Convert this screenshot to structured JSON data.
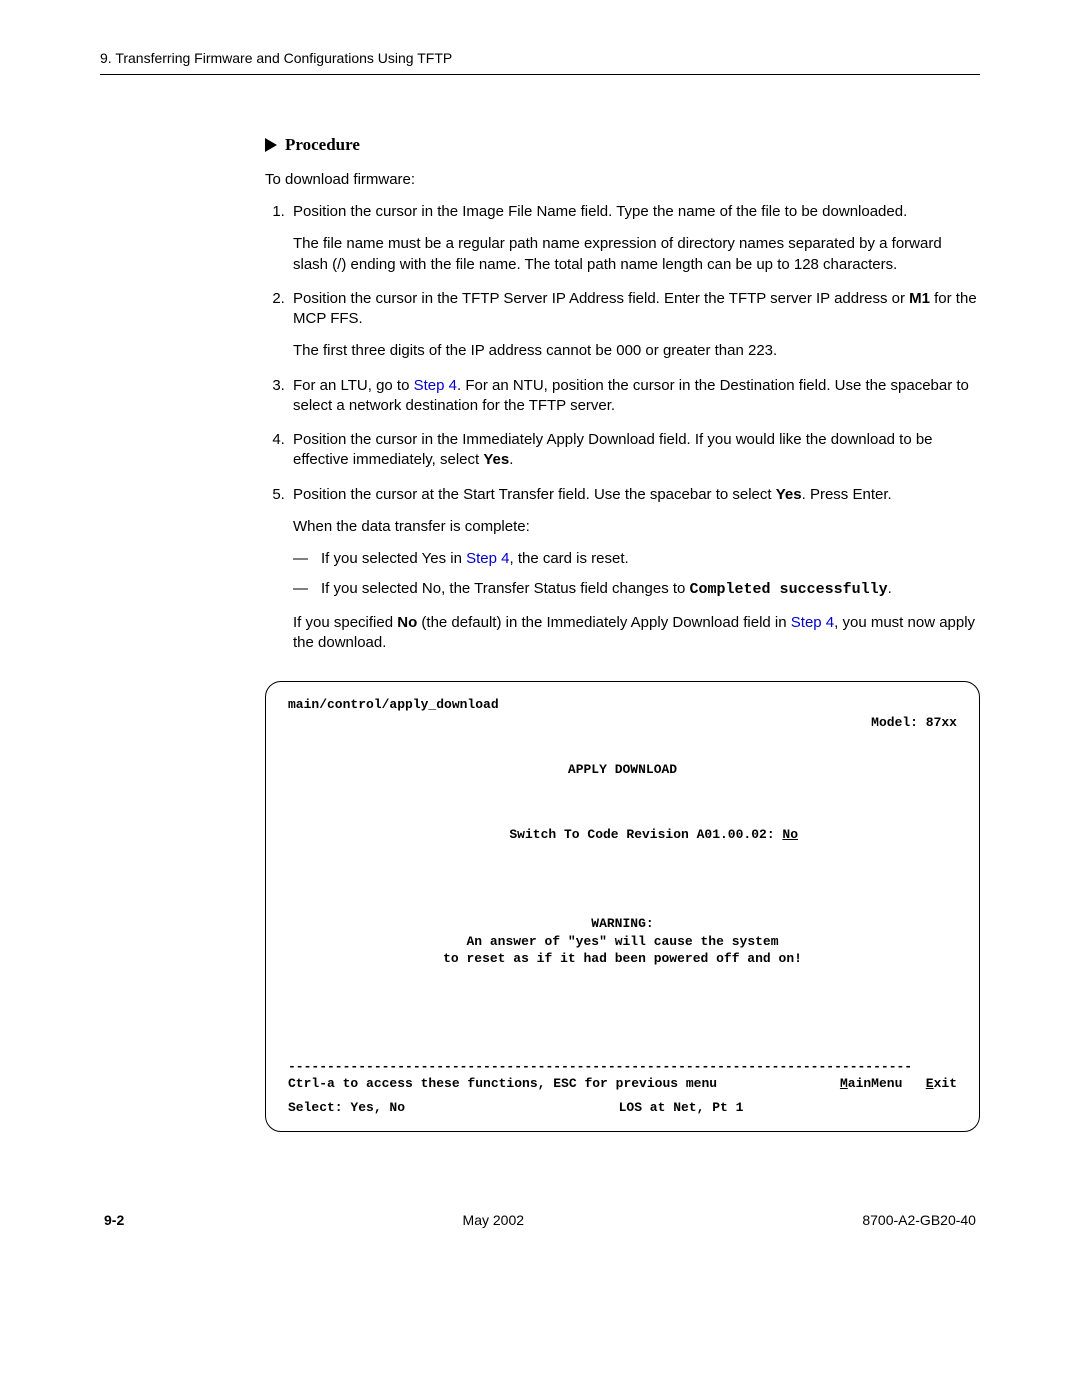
{
  "header": {
    "chapter_line": "9. Transferring Firmware and Configurations Using TFTP"
  },
  "procedure": {
    "label": "Procedure",
    "intro": "To download firmware:",
    "step1": {
      "text": "Position the cursor in the Image File Name field. Type the name of the file to be downloaded.",
      "para": "The file name must be a regular path name expression of directory names separated by a forward slash (/) ending with the file name. The total path name length can be up to 128 characters."
    },
    "step2": {
      "text_a": "Position the cursor in the TFTP Server IP Address field. Enter the TFTP server IP address or ",
      "bold": "M1",
      "text_b": " for the MCP FFS.",
      "para": "The first three digits of the IP address cannot be 000 or greater than 223."
    },
    "step3": {
      "pre": "For an LTU, go to ",
      "link": "Step 4",
      "post": ". For an NTU, position the cursor in the Destination field. Use the spacebar to select a network destination for the TFTP server."
    },
    "step4": {
      "text_a": "Position the cursor in the Immediately Apply Download field. If you would like the download to be effective immediately, select ",
      "bold": "Yes",
      "text_b": "."
    },
    "step5": {
      "text_a": "Position the cursor at the Start Transfer field. Use the spacebar to select ",
      "bold": "Yes",
      "text_b": ". Press Enter.",
      "para": "When the data transfer is complete:",
      "bullet1_pre": "If you selected Yes in ",
      "bullet1_link": "Step 4",
      "bullet1_post": ", the card is reset.",
      "bullet2_pre": "If you selected No, the Transfer Status field changes to ",
      "bullet2_mono": "Completed successfully",
      "bullet2_post": ".",
      "tail_pre": "If you specified ",
      "tail_bold": "No",
      "tail_mid": " (the default) in the Immediately Apply Download field in ",
      "tail_link": "Step 4",
      "tail_post": ", you must now apply the download."
    }
  },
  "terminal": {
    "path": "main/control/apply_download",
    "model": "Model: 87xx",
    "title": "APPLY DOWNLOAD",
    "switch_label": "Switch To Code Revision A01.00.02: ",
    "switch_value": "No",
    "warn_hdr": "WARNING:",
    "warn_l1": "An answer of \"yes\" will cause the system",
    "warn_l2": "to reset as if it had been powered off and on!",
    "sep": "--------------------------------------------------------------------------------",
    "nav_instr": "Ctrl-a to access these functions, ESC for previous menu",
    "nav_main_u": "M",
    "nav_main_r": "ainMenu",
    "nav_exit_u": "E",
    "nav_exit_r": "xit",
    "select": "Select: Yes, No",
    "status": "LOS at Net, Pt 1"
  },
  "footer": {
    "page": "9-2",
    "date": "May 2002",
    "doc": "8700-A2-GB20-40"
  }
}
